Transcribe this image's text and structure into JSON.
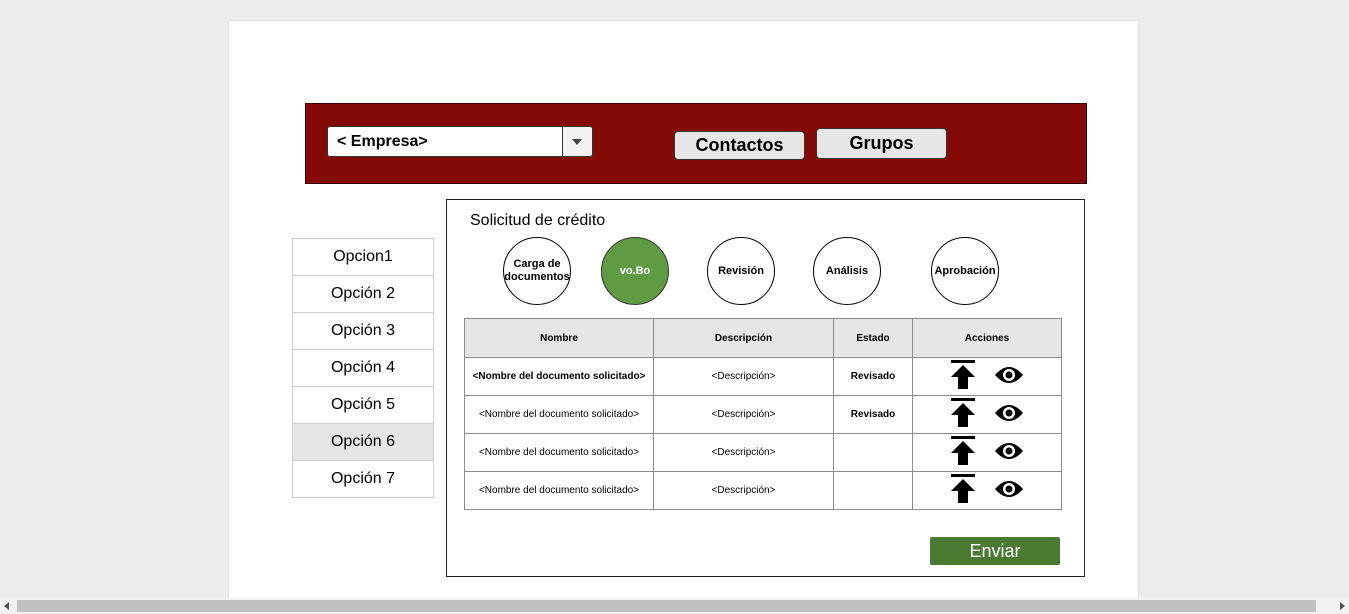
{
  "header": {
    "company_select": {
      "value": "< Empresa>"
    },
    "contacts_label": "Contactos",
    "groups_label": "Grupos",
    "background_color": "#840a06"
  },
  "sidebar": {
    "items": [
      {
        "label": "Opcion1",
        "active": false
      },
      {
        "label": "Opción 2",
        "active": false
      },
      {
        "label": "Opción 3",
        "active": false
      },
      {
        "label": "Opción 4",
        "active": false
      },
      {
        "label": "Opción 5",
        "active": false
      },
      {
        "label": "Opción 6",
        "active": true
      },
      {
        "label": "Opción 7",
        "active": false
      }
    ]
  },
  "panel": {
    "title": "Solicitud de crédito",
    "steps": [
      {
        "label": "Carga de documentos",
        "active": false
      },
      {
        "label": "vo.Bo",
        "active": true
      },
      {
        "label": "Revisión",
        "active": false
      },
      {
        "label": "Análisis",
        "active": false
      },
      {
        "label": "Aprobación",
        "active": false
      }
    ],
    "table": {
      "columns": [
        "Nombre",
        "Descripción",
        "Estado",
        "Acciones"
      ],
      "rows": [
        {
          "nombre": "<Nombre del documento solicitado>",
          "descripcion": "<Descripción>",
          "estado": "Revisado"
        },
        {
          "nombre": "<Nombre del documento solicitado>",
          "descripcion": "<Descripción>",
          "estado": "Revisado"
        },
        {
          "nombre": "<Nombre del documento solicitado>",
          "descripcion": "<Descripción>",
          "estado": ""
        },
        {
          "nombre": "<Nombre del documento solicitado>",
          "descripcion": "<Descripción>",
          "estado": ""
        }
      ],
      "action_icons": [
        "upload-icon",
        "eye-icon"
      ]
    },
    "submit_label": "Enviar"
  },
  "colors": {
    "accent_green": "#5e9b42",
    "button_green": "#4a7a32"
  }
}
